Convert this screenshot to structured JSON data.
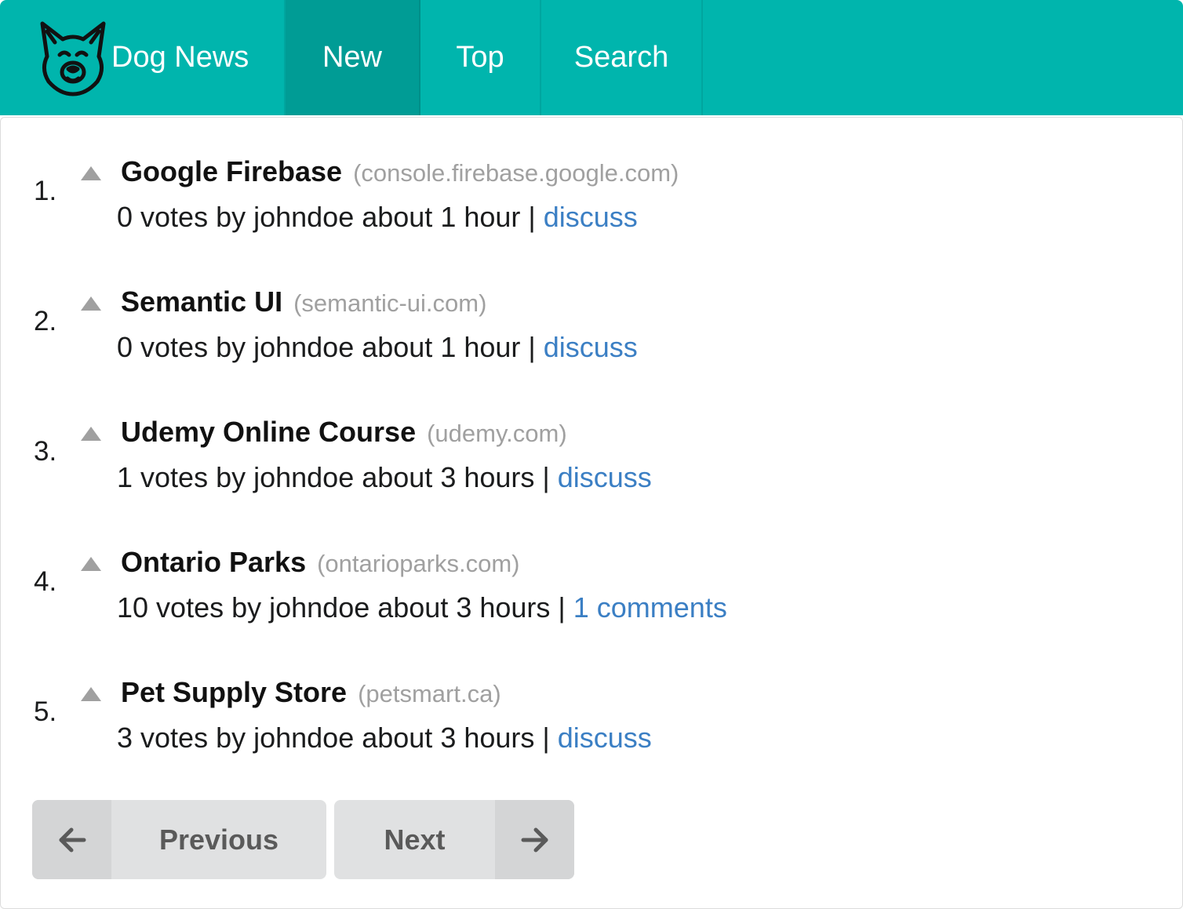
{
  "header": {
    "brand": "Dog News",
    "brand_icon": "dog-face-icon",
    "items": [
      {
        "label": "New",
        "active": true
      },
      {
        "label": "Top",
        "active": false
      },
      {
        "label": "Search",
        "active": false
      }
    ],
    "bg_color": "#00b5ad",
    "active_color": "#009c95"
  },
  "stories": [
    {
      "rank": "1.",
      "title": "Google Firebase",
      "domain": "(console.firebase.google.com)",
      "meta": "0 votes by johndoe about 1 hour | ",
      "link": "discuss"
    },
    {
      "rank": "2.",
      "title": "Semantic UI",
      "domain": "(semantic-ui.com)",
      "meta": "0 votes by johndoe about 1 hour | ",
      "link": "discuss"
    },
    {
      "rank": "3.",
      "title": "Udemy Online Course",
      "domain": "(udemy.com)",
      "meta": "1 votes by johndoe about 3 hours | ",
      "link": "discuss"
    },
    {
      "rank": "4.",
      "title": "Ontario Parks",
      "domain": "(ontarioparks.com)",
      "meta": "10 votes by johndoe about 3 hours | ",
      "link": "1 comments"
    },
    {
      "rank": "5.",
      "title": "Pet Supply Store",
      "domain": "(petsmart.ca)",
      "meta": "3 votes by johndoe about 3 hours | ",
      "link": "discuss"
    }
  ],
  "pagination": {
    "previous": "Previous",
    "next": "Next",
    "previous_icon": "arrow-left-icon",
    "next_icon": "arrow-right-icon"
  },
  "colors": {
    "link": "#3b7fc4",
    "domain": "#a0a0a0",
    "vote_arrow": "#a0a0a0"
  }
}
